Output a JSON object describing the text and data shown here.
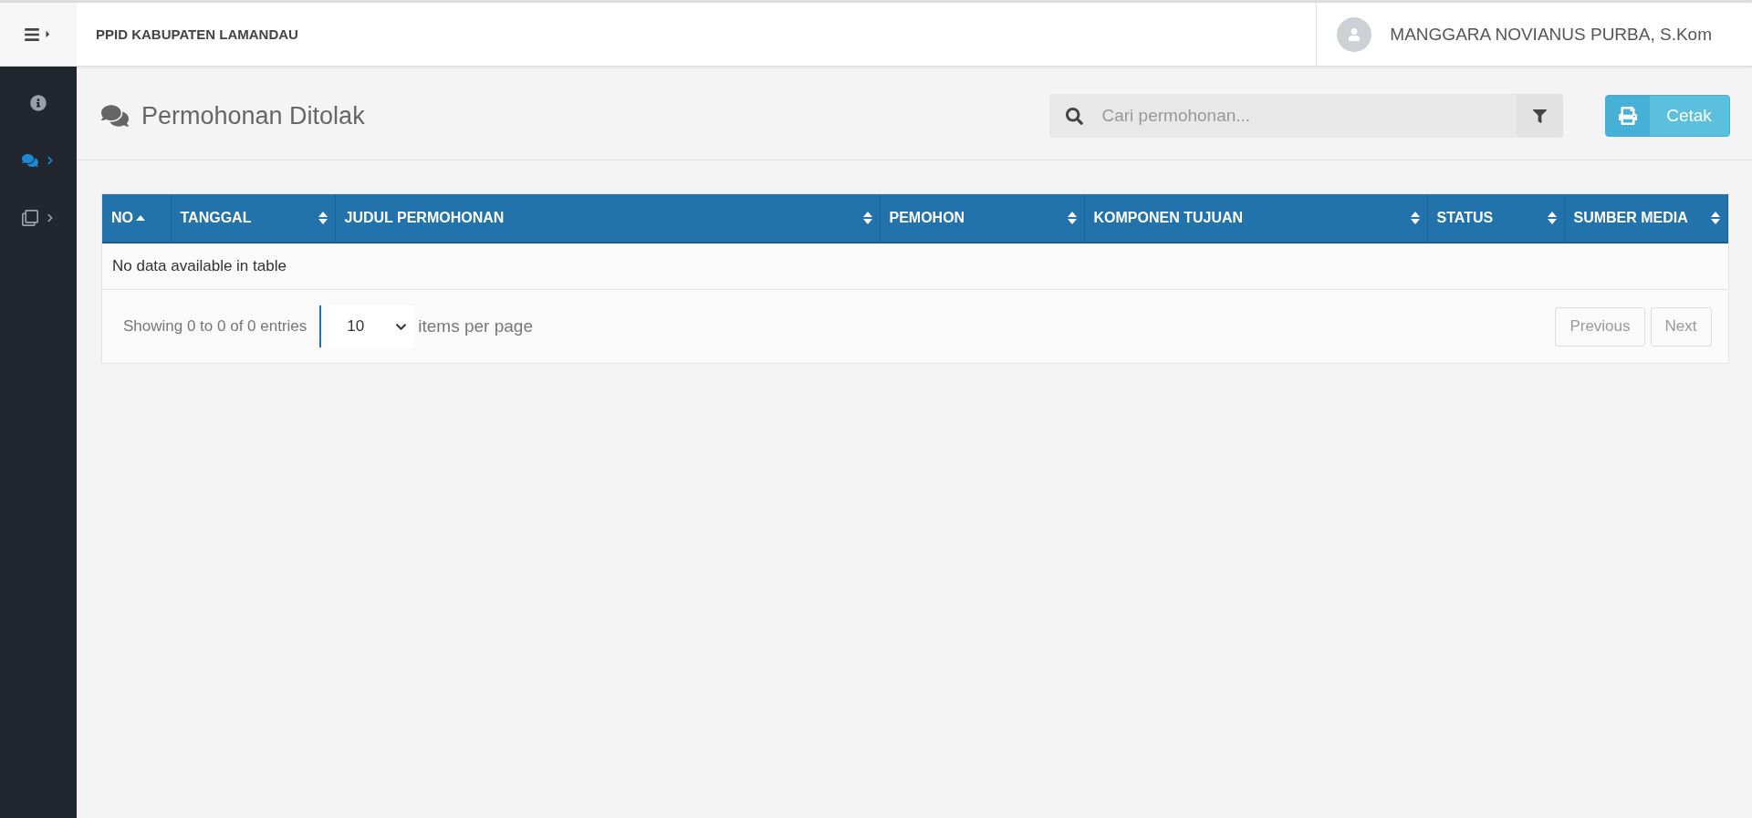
{
  "header": {
    "brand": "PPID KABUPATEN LAMANDAU",
    "user": "MANGGARA NOVIANUS PURBA, S.Kom"
  },
  "sidebar": {
    "items": [
      {
        "selected": false,
        "expandable": false
      },
      {
        "selected": true,
        "expandable": true
      },
      {
        "selected": false,
        "expandable": true
      }
    ]
  },
  "page": {
    "title": "Permohonan Ditolak",
    "search": {
      "placeholder": "Cari permohonan..."
    },
    "print_button": "Cetak"
  },
  "table": {
    "columns": [
      {
        "label": "NO",
        "sorted": true
      },
      {
        "label": "TANGGAL",
        "sorted": false
      },
      {
        "label": "JUDUL PERMOHONAN",
        "sorted": false
      },
      {
        "label": "PEMOHON",
        "sorted": false
      },
      {
        "label": "KOMPONEN TUJUAN",
        "sorted": false
      },
      {
        "label": "STATUS",
        "sorted": false
      },
      {
        "label": "SUMBER MEDIA",
        "sorted": false
      }
    ],
    "empty_message": "No data available in table"
  },
  "footer": {
    "info": "Showing 0 to 0 of 0 entries",
    "page_size": "10",
    "page_size_label": "items per page",
    "pager": [
      {
        "label": "Previous",
        "disabled": true
      },
      {
        "label": "Next",
        "disabled": true
      }
    ]
  }
}
